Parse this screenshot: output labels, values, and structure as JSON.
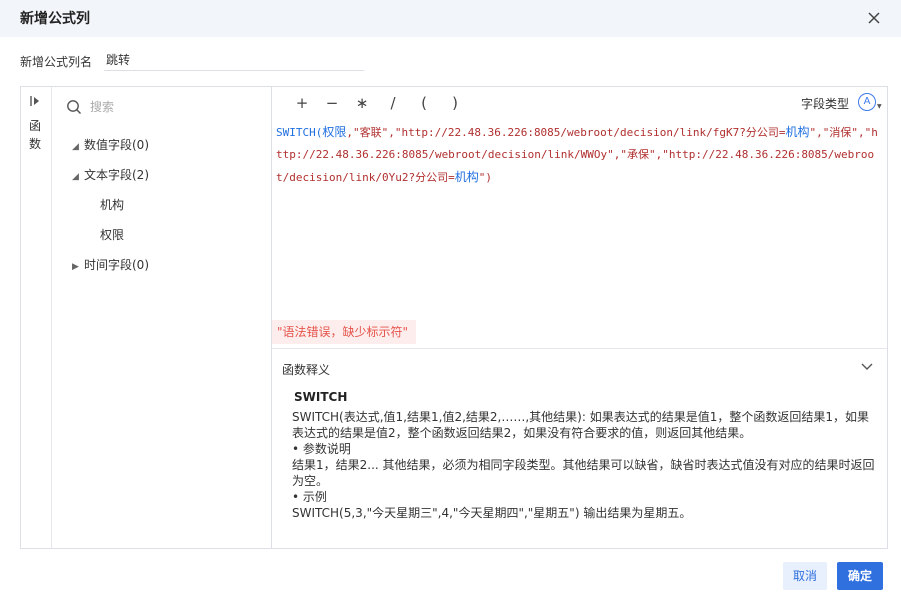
{
  "dialog": {
    "title": "新增公式列"
  },
  "name_field": {
    "label": "新增公式列名",
    "value": "跳转"
  },
  "function_tab": {
    "label": "函数"
  },
  "search": {
    "placeholder": "搜索"
  },
  "tree": {
    "numeric": "数值字段(0)",
    "text": "文本字段(2)",
    "text_children": [
      "机构",
      "权限"
    ],
    "time": "时间字段(0)"
  },
  "toolbar": {
    "plus": "+",
    "minus": "−",
    "multiply": "∗",
    "divide": "/",
    "lparen": "(",
    "rparen": ")",
    "field_type_label": "字段类型"
  },
  "formula": {
    "fn": "SWITCH(",
    "p1": "权限",
    "s1": ",\"客联\",\"http://22.48.36.226:8085/webroot/decision/link/fgK7?分公司=",
    "p2": "机构",
    "s2": "\",\"消保\",\"http://22.48.36.226:8085/webroot/decision/link/WWOy\",\"承保\",\"http://22.48.36.226:8085/webroot/decision/link/0Yu2?分公司=",
    "p3": "机构",
    "s3": "\")"
  },
  "error": "\"语法错误，缺少标示符\"",
  "help": {
    "title": "函数释义",
    "fn_name": "SWITCH",
    "lines": [
      "SWITCH(表达式,值1,结果1,值2,结果2,……,其他结果): 如果表达式的结果是值1，整个函数返回结果1，如果表达式的结果是值2，整个函数返回结果2，如果没有符合要求的值，则返回其他结果。",
      "•  参数说明",
      "结果1，结果2... 其他结果，必须为相同字段类型。其他结果可以缺省，缺省时表达式值没有对应的结果时返回为空。",
      "•  示例",
      "SWITCH(5,3,\"今天星期三\",4,\"今天星期四\",\"星期五\") 输出结果为星期五。"
    ]
  },
  "buttons": {
    "cancel": "取消",
    "ok": "确定"
  },
  "colors": {
    "primary": "#2f6fde",
    "error": "#e5544b",
    "error_bg": "#fdeded",
    "titlebar": "#f2f5fa"
  },
  "icons": [
    "close-icon",
    "collapse-arrow-icon",
    "search-icon",
    "caret-down-icon",
    "caret-right-icon",
    "field-type-icon",
    "chevron-down-icon"
  ]
}
